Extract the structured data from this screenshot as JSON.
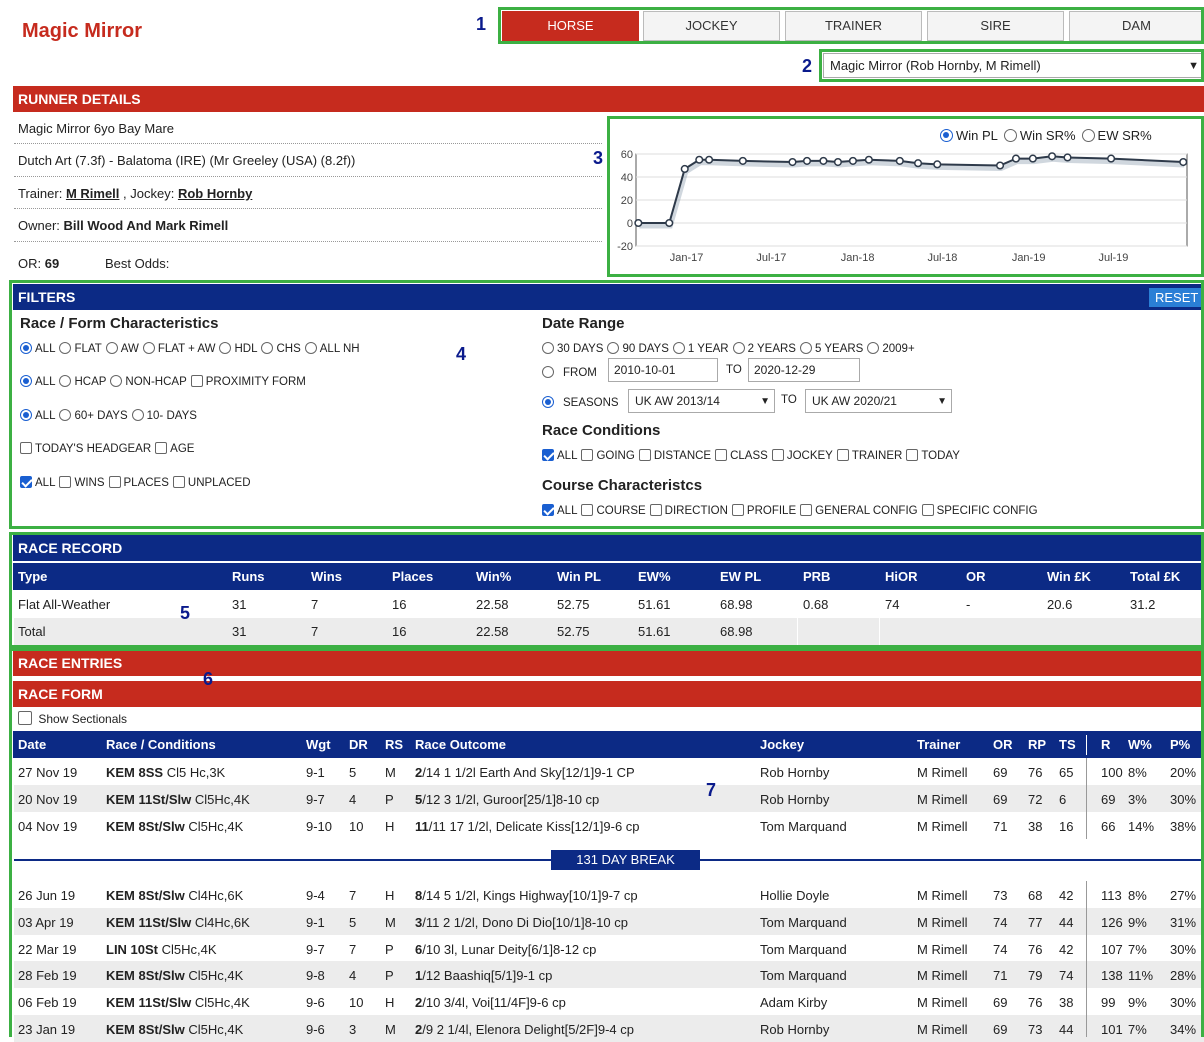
{
  "header": {
    "title": "Magic Mirror",
    "tabs": [
      "HORSE",
      "JOCKEY",
      "TRAINER",
      "SIRE",
      "DAM"
    ],
    "runner_select": "Magic Mirror (Rob Hornby, M Rimell)"
  },
  "annotations": [
    "1",
    "2",
    "3",
    "4",
    "5",
    "6",
    "7"
  ],
  "runner_details": {
    "heading": "RUNNER DETAILS",
    "line1": "Magic Mirror 6yo Bay Mare",
    "line2": "Dutch Art (7.3f) - Balatoma (IRE) (Mr Greeley (USA) (8.2f))",
    "trainer_label": "Trainer:",
    "trainer": "M Rimell",
    "jockey_label": ", Jockey:",
    "jockey": "Rob Hornby",
    "owner_label": "Owner:",
    "owner": "Bill Wood And Mark Rimell",
    "or_label": "OR:",
    "or_value": "69",
    "best_odds_label": "Best Odds:"
  },
  "chart_options": [
    "Win PL",
    "Win SR%",
    "EW SR%"
  ],
  "chart_data": {
    "type": "line",
    "series": [
      {
        "values": [
          [
            "2016-09-20",
            0
          ],
          [
            "2016-11-25",
            0
          ],
          [
            "2016-12-28",
            47
          ],
          [
            "2017-01-28",
            55
          ],
          [
            "2017-02-18",
            55
          ],
          [
            "2017-05-01",
            54
          ],
          [
            "2017-08-15",
            53
          ],
          [
            "2017-09-15",
            54
          ],
          [
            "2017-10-20",
            54
          ],
          [
            "2017-11-20",
            53
          ],
          [
            "2017-12-22",
            54
          ],
          [
            "2018-01-25",
            55
          ],
          [
            "2018-04-01",
            54
          ],
          [
            "2018-05-10",
            52
          ],
          [
            "2018-06-20",
            51
          ],
          [
            "2018-11-01",
            50
          ],
          [
            "2018-12-05",
            56
          ],
          [
            "2019-01-10",
            56
          ],
          [
            "2019-02-20",
            58
          ],
          [
            "2019-03-25",
            57
          ],
          [
            "2019-06-26",
            56
          ],
          [
            "2019-11-27",
            53
          ]
        ]
      }
    ],
    "x_ticks": [
      "Jan-17",
      "Jul-17",
      "Jan-18",
      "Jul-18",
      "Jan-19",
      "Jul-19"
    ],
    "y_ticks": [
      "60",
      "40",
      "20",
      "0",
      "-20"
    ],
    "ylim": [
      -20,
      60
    ],
    "xlim": [
      "2016-09-15",
      "2019-12-05"
    ],
    "grid": "horizontal"
  },
  "filters": {
    "heading": "FILTERS",
    "reset": "RESET",
    "race_form_heading": "Race / Form Characteristics",
    "row1": [
      "ALL",
      "FLAT",
      "AW",
      "FLAT + AW",
      "HDL",
      "CHS",
      "ALL NH"
    ],
    "row2": [
      "ALL",
      "HCAP",
      "NON-HCAP"
    ],
    "row2_cb": "PROXIMITY FORM",
    "row3": [
      "ALL",
      "60+ DAYS",
      "10- DAYS"
    ],
    "row4": [
      "TODAY'S HEADGEAR",
      "AGE"
    ],
    "row5": [
      "ALL",
      "WINS",
      "PLACES",
      "UNPLACED"
    ],
    "date_range_heading": "Date Range",
    "date_row": [
      "30 DAYS",
      "90 DAYS",
      "1 YEAR",
      "2 YEARS",
      "5 YEARS",
      "2009+"
    ],
    "from_label": "FROM",
    "from_value": "2010-10-01",
    "to_label": "TO",
    "to_value": "2020-12-29",
    "seasons_label": "SEASONS",
    "season_from": "UK AW 2013/14",
    "season_to": "UK AW 2020/21",
    "race_conditions_heading": "Race Conditions",
    "race_conditions": [
      "ALL",
      "GOING",
      "DISTANCE",
      "CLASS",
      "JOCKEY",
      "TRAINER",
      "TODAY"
    ],
    "course_heading": "Course Characteristcs",
    "course": [
      "ALL",
      "COURSE",
      "DIRECTION",
      "PROFILE",
      "GENERAL CONFIG",
      "SPECIFIC CONFIG"
    ]
  },
  "race_record": {
    "heading": "RACE RECORD",
    "columns": [
      "Type",
      "Runs",
      "Wins",
      "Places",
      "Win%",
      "Win PL",
      "EW%",
      "EW PL",
      "PRB",
      "HiOR",
      "OR",
      "Win £K",
      "Total £K"
    ],
    "rows": [
      [
        "Flat All-Weather",
        "31",
        "7",
        "16",
        "22.58",
        "52.75",
        "51.61",
        "68.98",
        "0.68",
        "74",
        "-",
        "20.6",
        "31.2"
      ],
      [
        "Total",
        "31",
        "7",
        "16",
        "22.58",
        "52.75",
        "51.61",
        "68.98",
        "",
        "",
        "",
        "",
        ""
      ]
    ]
  },
  "race_entries": {
    "heading": "RACE ENTRIES"
  },
  "race_form": {
    "heading": "RACE FORM",
    "show_sectionals": "Show Sectionals",
    "columns": [
      "Date",
      "Race / Conditions",
      "Wgt",
      "DR",
      "RS",
      "Race Outcome",
      "Jockey",
      "Trainer",
      "OR",
      "RP",
      "TS",
      "R",
      "W%",
      "P%"
    ],
    "rows_top": [
      [
        "27 Nov 19",
        "KEM 8SS",
        "Cl5 Hc,3K",
        "9-1",
        "5",
        "M",
        "2",
        "/14 1 1/2l Earth And Sky[12/1]9-1 CP",
        "Rob Hornby",
        "M Rimell",
        "69",
        "76",
        "65",
        "100",
        "8%",
        "20%"
      ],
      [
        "20 Nov 19",
        "KEM 11St/Slw",
        "Cl5Hc,4K",
        "9-7",
        "4",
        "P",
        "5",
        "/12 3 1/2l, Guroor[25/1]8-10 cp",
        "Rob Hornby",
        "M Rimell",
        "69",
        "72",
        "6",
        "69",
        "3%",
        "30%"
      ],
      [
        "04 Nov 19",
        "KEM 8St/Slw",
        "Cl5Hc,4K",
        "9-10",
        "10",
        "H",
        "11",
        "/11 17 1/2l, Delicate Kiss[12/1]9-6 cp",
        "Tom Marquand",
        "M Rimell",
        "71",
        "38",
        "16",
        "66",
        "14%",
        "38%"
      ]
    ],
    "break_label": "131 DAY BREAK",
    "rows_bottom": [
      [
        "26 Jun 19",
        "KEM 8St/Slw",
        "Cl4Hc,6K",
        "9-4",
        "7",
        "H",
        "8",
        "/14 5 1/2l, Kings Highway[10/1]9-7 cp",
        "Hollie Doyle",
        "M Rimell",
        "73",
        "68",
        "42",
        "113",
        "8%",
        "27%"
      ],
      [
        "03 Apr 19",
        "KEM 11St/Slw",
        "Cl4Hc,6K",
        "9-1",
        "5",
        "M",
        "3",
        "/11 2 1/2l, Dono Di Dio[10/1]8-10 cp",
        "Tom Marquand",
        "M Rimell",
        "74",
        "77",
        "44",
        "126",
        "9%",
        "31%"
      ],
      [
        "22 Mar 19",
        "LIN 10St",
        "Cl5Hc,4K",
        "9-7",
        "7",
        "P",
        "6",
        "/10 3l, Lunar Deity[6/1]8-12 cp",
        "Tom Marquand",
        "M Rimell",
        "74",
        "76",
        "42",
        "107",
        "7%",
        "30%"
      ],
      [
        "28 Feb 19",
        "KEM 8St/Slw",
        "Cl5Hc,4K",
        "9-8",
        "4",
        "P",
        "1",
        "/12 Baashiq[5/1]9-1 cp",
        "Tom Marquand",
        "M Rimell",
        "71",
        "79",
        "74",
        "138",
        "11%",
        "28%"
      ],
      [
        "06 Feb 19",
        "KEM 11St/Slw",
        "Cl5Hc,4K",
        "9-6",
        "10",
        "H",
        "2",
        "/10 3/4l, Voi[11/4F]9-6 cp",
        "Adam Kirby",
        "M Rimell",
        "69",
        "76",
        "38",
        "99",
        "9%",
        "30%"
      ],
      [
        "23 Jan 19",
        "KEM 8St/Slw",
        "Cl5Hc,4K",
        "9-6",
        "3",
        "M",
        "2",
        "/9 2 1/4l, Elenora Delight[5/2F]9-4 cp",
        "Rob Hornby",
        "M Rimell",
        "69",
        "73",
        "44",
        "101",
        "7%",
        "34%"
      ]
    ]
  }
}
